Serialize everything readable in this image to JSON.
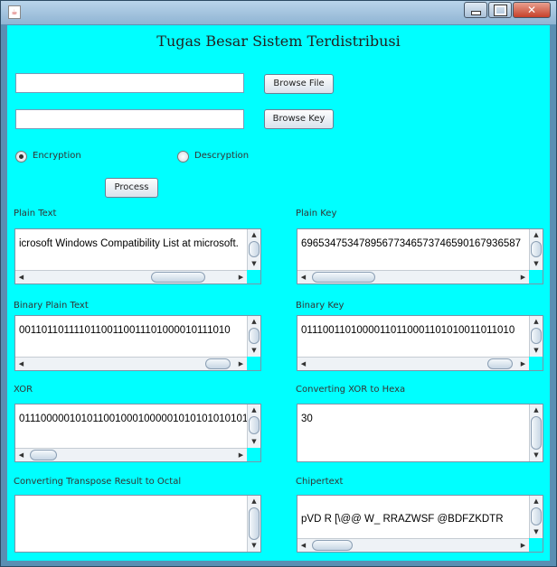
{
  "window": {
    "title": ""
  },
  "app": {
    "heading": "Tugas Besar Sistem Terdistribusi"
  },
  "inputs": {
    "file_value": "",
    "key_value": ""
  },
  "buttons": {
    "browse_file": "Browse File",
    "browse_key": "Browse Key",
    "process": "Process"
  },
  "mode": {
    "encryption_label": "Encryption",
    "decryption_label": "Descryption",
    "selected": "Encryption"
  },
  "panels": {
    "plain_text": {
      "label": "Plain Text",
      "value": "icrosoft Windows Compatibility List at microsoft."
    },
    "plain_key": {
      "label": "Plain Key",
      "value": "69653475347895677346573746590167936587"
    },
    "binary_plain_text": {
      "label": "Binary Plain Text",
      "value": "00110110111101100110011101000010111010"
    },
    "binary_key": {
      "label": "Binary Key",
      "value": "01110011010000110110001101010011011010"
    },
    "xor": {
      "label": "XOR",
      "value": "0111000001010110010001000001010101010101"
    },
    "xor_hex": {
      "label": "Converting XOR to Hexa",
      "value": "30"
    },
    "octal": {
      "label": "Converting Transpose Result to Octal",
      "value": ""
    },
    "chipertext": {
      "label": "Chipertext",
      "value": "pVD  R  [\\@@  W_  RRAZWSF  @BDFZKDTR"
    }
  },
  "icons": {
    "app": "java-cup-icon",
    "minimize": "minimize-icon",
    "maximize": "maximize-icon",
    "close": "close-icon"
  },
  "colors": {
    "background": "#00ffff",
    "close_button": "#c7402a"
  }
}
